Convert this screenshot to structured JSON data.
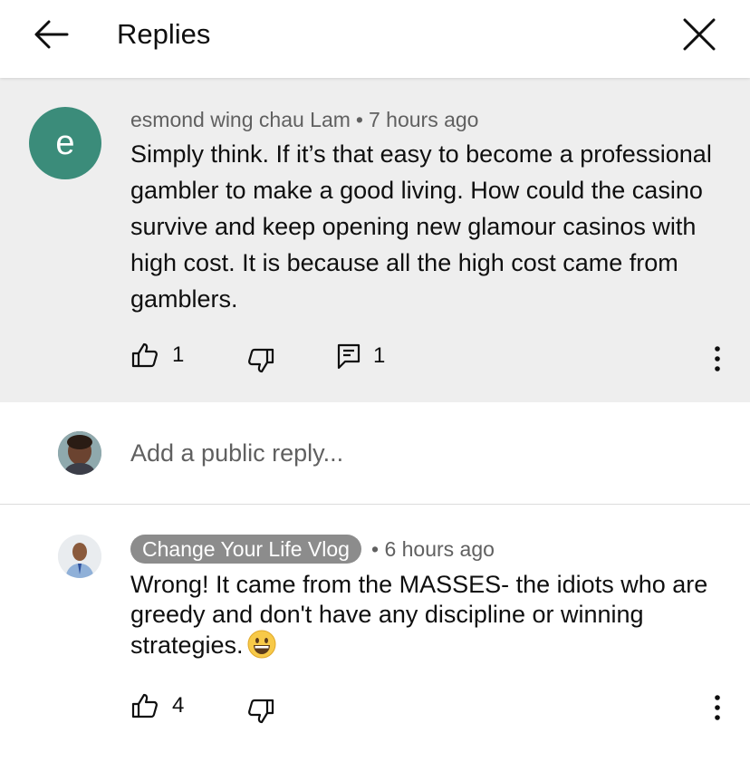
{
  "header": {
    "title": "Replies",
    "back_icon": "arrow-left-icon",
    "close_icon": "close-icon"
  },
  "parent_comment": {
    "avatar_letter": "e",
    "avatar_color": "#3b8c7a",
    "author": "esmond wing chau Lam",
    "time": "7 hours ago",
    "text": "Simply think. If it’s that easy to become a professional gambler to make a good living.  How could the casino survive and keep opening new glamour casinos with high cost. It is because all the high cost came from gamblers.",
    "likes": "1",
    "replies": "1"
  },
  "reply_input": {
    "placeholder": "Add a public reply..."
  },
  "reply_comment": {
    "author": "Change Your Life Vlog",
    "time": "6 hours ago",
    "text": "Wrong! It came from the MASSES- the idiots who are greedy and don't have any discipline or winning strategies.",
    "emoji": "grinning-face",
    "likes": "4"
  },
  "colors": {
    "parent_background": "#eeeeee",
    "author_chip": "#8c8c8c",
    "meta_text": "#606060"
  }
}
